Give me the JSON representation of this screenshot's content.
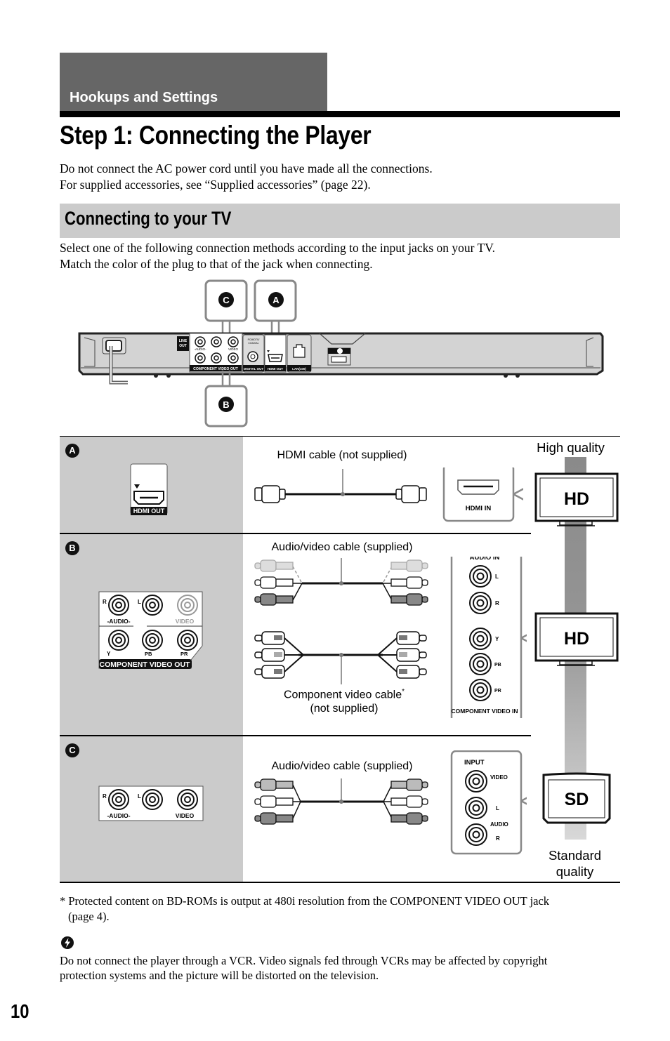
{
  "header": {
    "section_tab": "Hookups and Settings",
    "page_title": "Step 1: Connecting the Player",
    "intro_lines": [
      "Do not connect the AC power cord until you have made all the connections.",
      "For supplied accessories, see “Supplied accessories” (page 22)."
    ]
  },
  "subsection": {
    "title": "Connecting to your TV",
    "lines": [
      "Select one of the following connection methods according to the input jacks on your TV.",
      "Match the color of the plug to that of the jack when connecting."
    ]
  },
  "player_diagram": {
    "callouts": [
      "C",
      "A",
      "B"
    ],
    "panel_labels": {
      "line_out": [
        "LINE",
        "OUT"
      ],
      "audio": "-AUDIO-",
      "video": "VIDEO",
      "component_video_out": "COMPONENT VIDEO OUT",
      "coaxial": [
        "PCM/DTS/",
        "DOLBY",
        "DIGITAL",
        "COAXIAL"
      ],
      "digital_out": "DIGITAL OUT",
      "hdmi_out": "HDMI OUT",
      "lan": "LAN(100)"
    }
  },
  "connections": [
    {
      "id": "A",
      "player_jack_label": "HDMI OUT",
      "cable_label": "HDMI cable (not supplied)",
      "tv_jack_labels": [
        "HDMI IN"
      ],
      "tv_type": "HD",
      "quality_label": "High quality"
    },
    {
      "id": "B",
      "player_jack_labels": {
        "R": "R",
        "L": "L",
        "audio": "-AUDIO-",
        "video": "VIDEO",
        "Y": "Y",
        "PB": "PB",
        "PR": "PR",
        "footer": "COMPONENT VIDEO OUT"
      },
      "cable_label": "Audio/video cable (supplied)",
      "cable_label_2": "Component video cable",
      "cable_label_2_mark": "*",
      "cable_label_2_sub": "(not supplied)",
      "tv_jack_labels": {
        "audio_in": "AUDIO IN",
        "L": "L",
        "R": "R",
        "Y": "Y",
        "PB": "PB",
        "PR": "PR",
        "component_in": "COMPONENT VIDEO IN"
      },
      "tv_type": "HD"
    },
    {
      "id": "C",
      "player_jack_labels": {
        "R": "R",
        "L": "L",
        "audio": "-AUDIO-",
        "video": "VIDEO"
      },
      "cable_label": "Audio/video cable (supplied)",
      "tv_jack_labels": {
        "input": "INPUT",
        "video": "VIDEO",
        "L": "L",
        "audio": "AUDIO",
        "R": "R"
      },
      "tv_type": "SD",
      "quality_label_lines": [
        "Standard",
        "quality"
      ]
    }
  ],
  "footnote": {
    "line1": "* Protected content on BD-ROMs is output at 480i resolution from the COMPONENT VIDEO OUT jack",
    "line2": "(page 4)."
  },
  "note": {
    "icon": "note-bolt-icon",
    "lines": [
      "Do not connect the player through a VCR. Video signals fed through VCRs may be affected by copyright",
      "protection systems and the picture will be distorted on the television."
    ]
  },
  "page_number": "10",
  "colors": {
    "tab_bg": "#666666",
    "band_bg": "#cbcbcb",
    "ink": "#000000",
    "callout_border": "#888888"
  }
}
